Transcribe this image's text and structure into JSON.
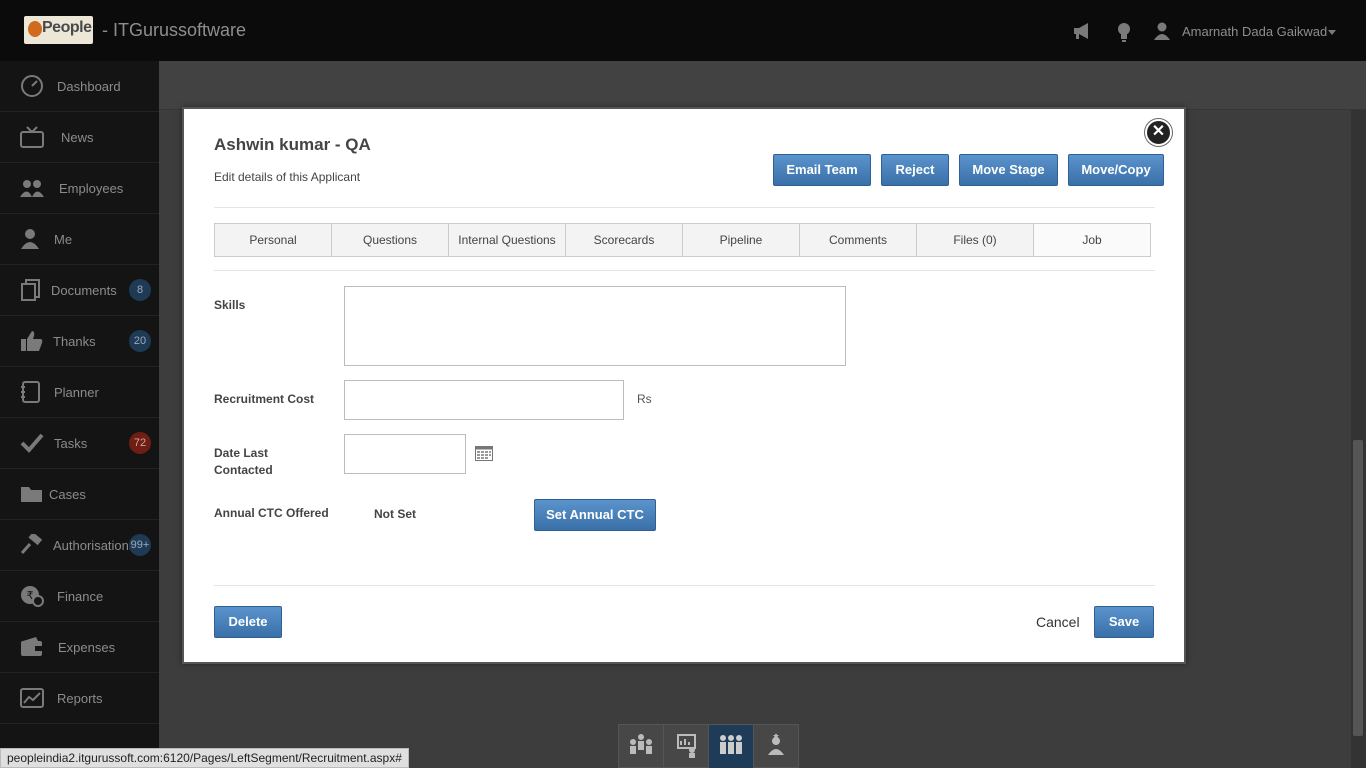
{
  "app": {
    "logo_text": "People",
    "title": "- ITGurussoftware",
    "user_name": "Amarnath Dada Gaikwad"
  },
  "sidebar": {
    "items": [
      {
        "label": "Dashboard",
        "icon": "dashboard-icon"
      },
      {
        "label": "News",
        "icon": "tv-icon"
      },
      {
        "label": "Employees",
        "icon": "people-icon"
      },
      {
        "label": "Me",
        "icon": "person-icon"
      },
      {
        "label": "Documents",
        "icon": "documents-icon",
        "badge": "8"
      },
      {
        "label": "Thanks",
        "icon": "thumbs-up-icon",
        "badge": "20"
      },
      {
        "label": "Planner",
        "icon": "planner-icon"
      },
      {
        "label": "Tasks",
        "icon": "check-icon",
        "badge": "72"
      },
      {
        "label": "Cases",
        "icon": "folder-icon"
      },
      {
        "label": "Authorisations",
        "icon": "gavel-icon",
        "badge": "99+"
      },
      {
        "label": "Finance",
        "icon": "rupee-icon"
      },
      {
        "label": "Expenses",
        "icon": "wallet-icon"
      },
      {
        "label": "Reports",
        "icon": "chart-icon"
      }
    ],
    "colors": {
      "badge_blue": "#1f3a55",
      "badge_red": "#6e1e14"
    }
  },
  "modal": {
    "title": "Ashwin kumar - QA",
    "subtitle": "Edit details of this Applicant",
    "actions": {
      "email_team": "Email Team",
      "reject": "Reject",
      "move_stage": "Move Stage",
      "move_copy": "Move/Copy"
    },
    "tabs": [
      "Personal",
      "Questions",
      "Internal Questions",
      "Scorecards",
      "Pipeline",
      "Comments",
      "Files (0)",
      "Job"
    ],
    "active_tab": "Job",
    "fields": {
      "skills_label": "Skills",
      "skills_value": "",
      "recruitment_cost_label": "Recruitment Cost",
      "recruitment_cost_value": "",
      "recruitment_cost_unit": "Rs",
      "date_last_contacted_label_line1": "Date Last",
      "date_last_contacted_label_line2": "Contacted",
      "date_last_contacted_value": "",
      "annual_ctc_label": "Annual CTC Offered",
      "annual_ctc_value": "Not Set",
      "set_annual_ctc": "Set Annual CTC"
    },
    "footer": {
      "delete": "Delete",
      "cancel": "Cancel",
      "save": "Save"
    },
    "accent_color": "#3a70a8"
  },
  "status_url": "peopleindia2.itgurussoft.com:6120/Pages/LeftSegment/Recruitment.aspx#"
}
